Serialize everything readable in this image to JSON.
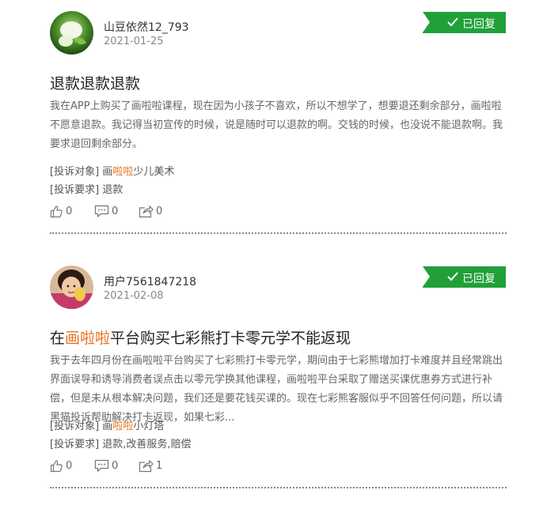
{
  "complaints": [
    {
      "user": "山豆依然12_793",
      "date": "2021-01-25",
      "status": "已回复",
      "title_prefix": "",
      "title_highlight": "",
      "title_suffix": "退款退款退款",
      "content": "我在APP上购买了画啦啦课程，现在因为小孩子不喜欢，所以不想学了，想要退还剩余部分，画啦啦不愿意退款。我记得当初宣传的时候，说是随时可以退款的啊。交钱的时候，也没说不能退款啊。我要求退回剩余部分。",
      "target_label": "[投诉对象]",
      "target_prefix": "画",
      "target_highlight": "啦啦",
      "target_suffix": "少儿美术",
      "request_label": "[投诉要求]",
      "request": "退款",
      "likes": "0",
      "comments": "0",
      "shares": "0"
    },
    {
      "user": "用户7561847218",
      "date": "2021-02-08",
      "status": "已回复",
      "title_prefix": "在",
      "title_highlight": "画啦啦",
      "title_suffix": "平台购买七彩熊打卡零元学不能返现",
      "content": "我于去年四月份在画啦啦平台购买了七彩熊打卡零元学，期间由于七彩熊增加打卡难度并且经常跳出界面误导和诱导消费者误点击以零元学换其他课程，画啦啦平台采取了赠送买课优惠券方式进行补偿，但是未从根本解决问题，我们还是要花钱买课的。现在七彩熊客服似乎不回答任何问题，所以请黑猫投诉帮助解决打卡返现，如果七彩...",
      "target_label": "[投诉对象]",
      "target_prefix": "画",
      "target_highlight": "啦啦",
      "target_suffix": "小灯塔",
      "request_label": "[投诉要求]",
      "request": "退款,改善服务,赔偿",
      "likes": "0",
      "comments": "0",
      "shares": "1"
    }
  ]
}
